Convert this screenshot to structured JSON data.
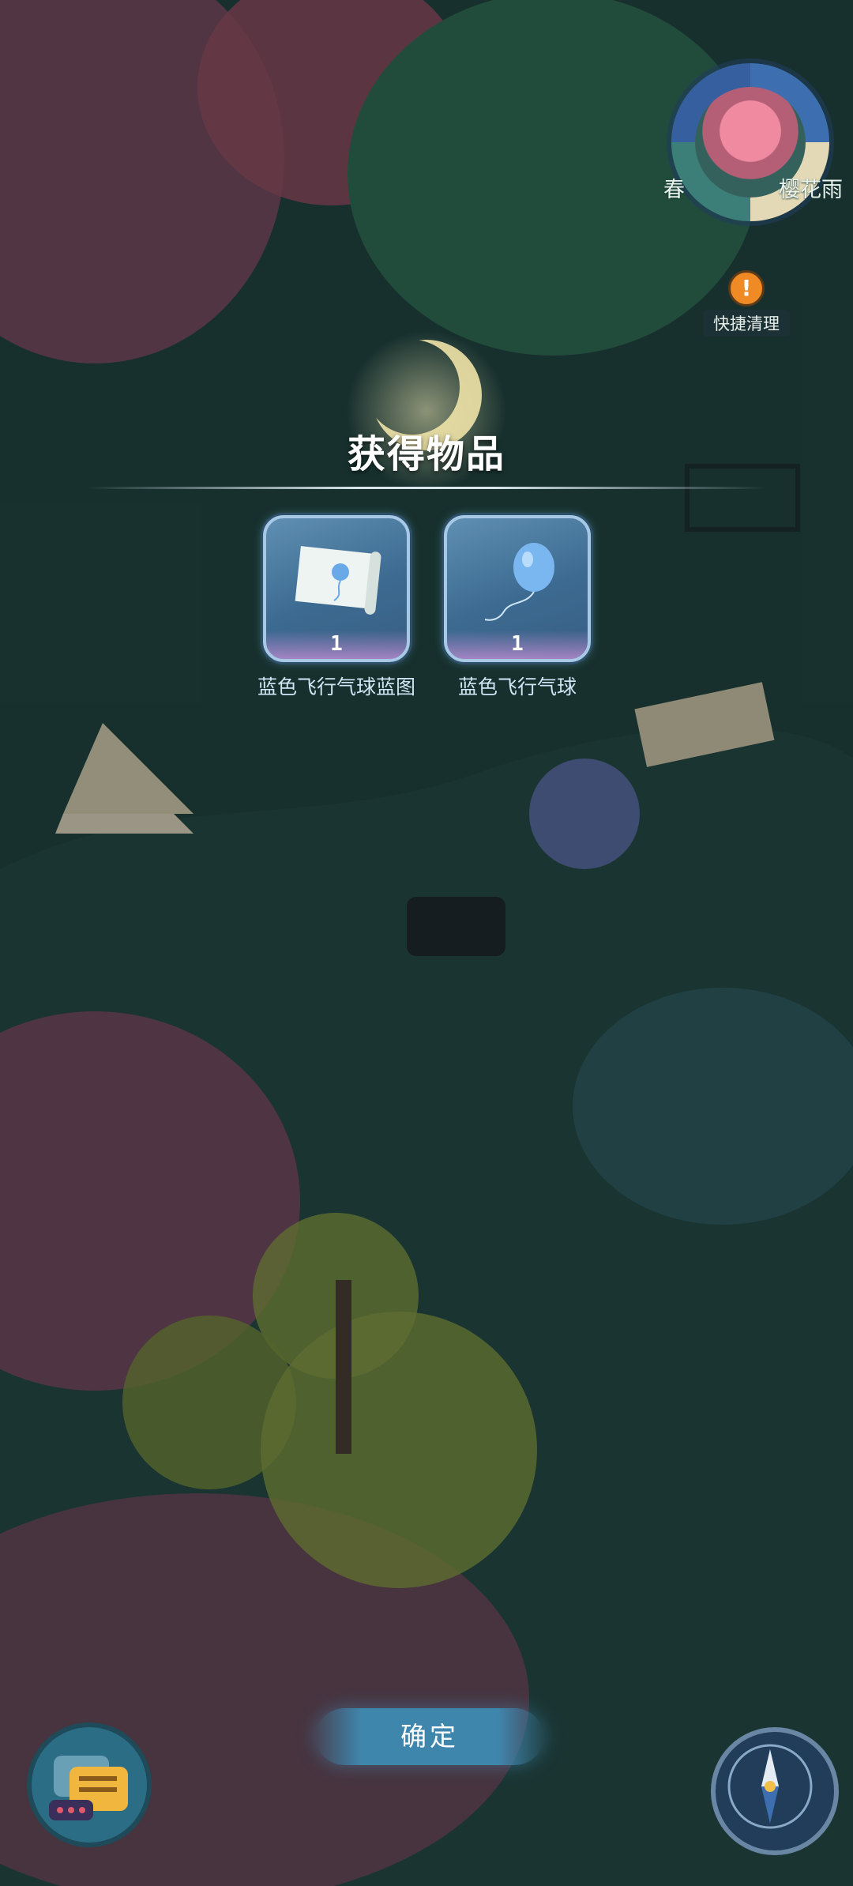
{
  "season": {
    "season_label": "春",
    "weather_label": "樱花雨",
    "quick_clean_label": "快捷清理"
  },
  "modal": {
    "title": "获得物品",
    "items": [
      {
        "name": "蓝色飞行气球蓝图",
        "count": "1",
        "icon": "balloon-blueprint-icon"
      },
      {
        "name": "蓝色飞行气球",
        "count": "1",
        "icon": "blue-balloon-icon"
      }
    ],
    "confirm_label": "确定"
  },
  "hud": {
    "chat_icon": "chat-bubbles-icon",
    "compass_icon": "compass-icon"
  },
  "colors": {
    "panel_blue": "#3c6a91",
    "accent_gold": "#efe3a8",
    "button_blue": "#3f86ad"
  }
}
